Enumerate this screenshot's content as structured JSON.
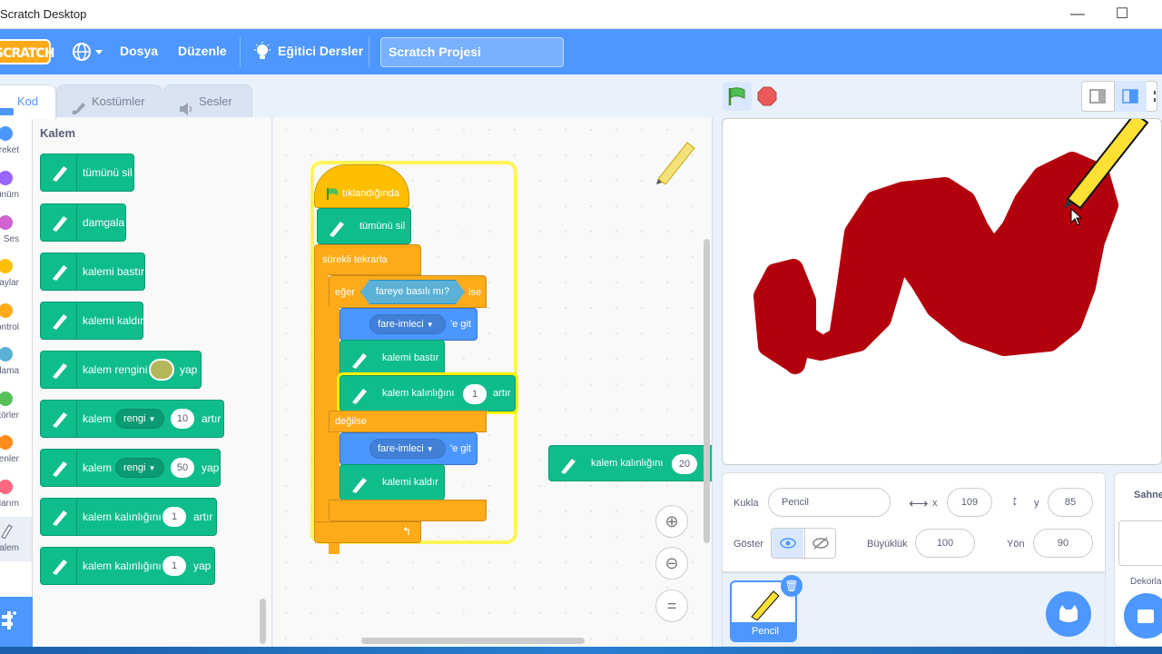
{
  "window": {
    "title": "Scratch Desktop",
    "minimize": "—",
    "maximize": "☐"
  },
  "menubar": {
    "logo": "SCRATCH",
    "file": "Dosya",
    "edit": "Düzenle",
    "tutorials": "Eğitici Dersler",
    "project_title": "Scratch Projesi"
  },
  "tabs": {
    "code": "Kod",
    "costumes": "Kostümler",
    "sounds": "Sesler"
  },
  "categories": [
    {
      "label": "Hareket",
      "color": "#4c97ff"
    },
    {
      "label": "Görünüm",
      "color": "#9966ff"
    },
    {
      "label": "Ses",
      "color": "#cf63cf"
    },
    {
      "label": "Olaylar",
      "color": "#ffbf00"
    },
    {
      "label": "Kontrol",
      "color": "#ffab19"
    },
    {
      "label": "Algılama",
      "color": "#5cb1d6"
    },
    {
      "label": "Operatörler",
      "color": "#59c059"
    },
    {
      "label": "Değişkenler",
      "color": "#ff8c1a"
    },
    {
      "label": "Bloklarım",
      "color": "#ff6680"
    },
    {
      "label": "Kalem",
      "color": "#0fbd8c"
    }
  ],
  "palette": {
    "title": "Kalem",
    "b1": "tümünü sil",
    "b2": "damgala",
    "b3": "kalemi bastır",
    "b4": "kalemi kaldır",
    "b5_a": "kalem rengini",
    "b5_b": "yap",
    "b6_a": "kalem",
    "b6_dd": "rengi",
    "b6_val": "10",
    "b6_b": "artır",
    "b7_a": "kalem",
    "b7_dd": "rengi",
    "b7_val": "50",
    "b7_b": "yap",
    "b8_a": "kalem kalınlığını",
    "b8_val": "1",
    "b8_b": "artır",
    "b9_a": "kalem kalınlığını",
    "b9_val": "1",
    "b9_b": "yap"
  },
  "script": {
    "hat": "tıklandığında",
    "clear": "tümünü sil",
    "forever": "sürekli tekrarla",
    "if": "eğer",
    "cond": "fareye basılı mı?",
    "then": "ise",
    "goto1": "fare-imleci",
    "goto_suffix1": "'e git",
    "pendown": "kalemi bastır",
    "change_size": "kalem kalınlığını",
    "change_val": "1",
    "change_b": "artır",
    "else": "değilse",
    "goto2": "fare-imleci",
    "goto_suffix2": "'e git",
    "penup": "kalemi kaldır",
    "loose_a": "kalem kalınlığını",
    "loose_val": "20"
  },
  "sprite": {
    "label_sprite": "Kukla",
    "name": "Pencil",
    "x_label": "x",
    "x": "109",
    "y_label": "y",
    "y": "85",
    "show_label": "Göster",
    "size_label": "Büyüklük",
    "size": "100",
    "dir_label": "Yön",
    "dir": "90",
    "thumb_name": "Pencil"
  },
  "stagepanel": {
    "title": "Sahne",
    "backdrops": "Dekorlar"
  }
}
